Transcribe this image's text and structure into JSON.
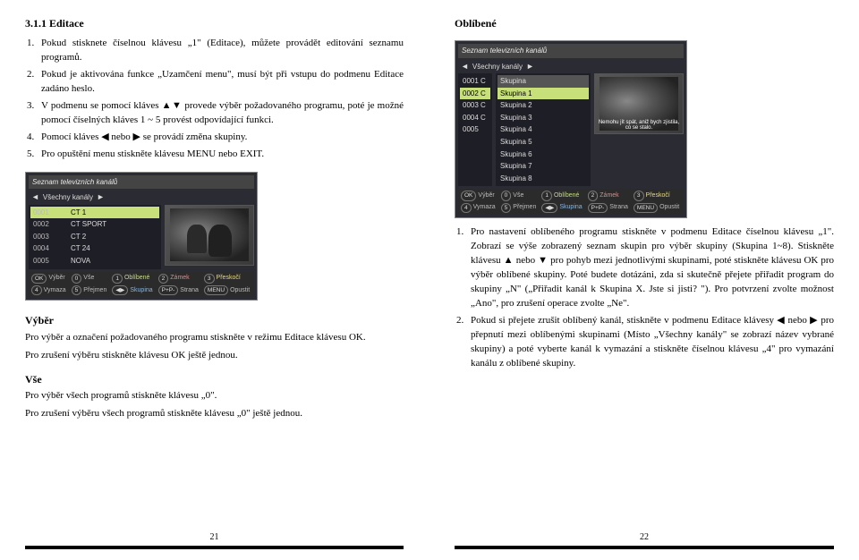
{
  "left": {
    "section_title": "3.1.1 Editace",
    "items": [
      "Pokud stisknete číselnou klávesu „1\" (Editace), můžete provádět editování seznamu programů.",
      "Pokud je aktivována funkce „Uzamčení menu\", musí být při vstupu do podmenu Editace zadáno heslo.",
      "V podmenu se pomocí kláves ▲▼ provede výběr požadovaného programu, poté je možné pomocí číselných kláves 1 ~ 5 provést odpovídající funkci.",
      "Pomocí kláves ◀ nebo ▶ se provádí změna skupiny.",
      "Pro opuštění menu stiskněte klávesu MENU nebo EXIT."
    ],
    "vyber_title": "Výběr",
    "vyber_p1": "Pro výběr a označení požadovaného programu stiskněte v režimu Editace klávesu OK.",
    "vyber_p2": "Pro zrušení výběru stiskněte klávesu OK ještě jednou.",
    "vse_title": "Vše",
    "vse_p1": "Pro výběr všech programů stiskněte klávesu „0\".",
    "vse_p2": "Pro zrušení výběru všech programů stiskněte klávesu „0\" ještě jednou.",
    "page_number": "21"
  },
  "right": {
    "oblibene_title": "Oblíbené",
    "items": [
      "Pro nastavení oblíbeného programu stiskněte v podmenu Editace číselnou klávesu „1\". Zobrazí se výše zobrazený seznam skupin pro výběr skupiny (Skupina 1~8). Stiskněte klávesu ▲ nebo ▼ pro pohyb mezi jednotlivými skupinami, poté stiskněte klávesu OK pro výběr oblíbené skupiny. Poté budete dotázáni, zda si skutečně přejete přiřadit program do skupiny „N\" („Přiřadit kanál k Skupina X. Jste si jisti? \"). Pro potvrzení zvolte možnost „Ano\", pro zrušení operace zvolte „Ne\".",
      "Pokud si přejete zrušit oblíbený kanál, stiskněte v podmenu Editace klávesy ◀ nebo ▶ pro přepnutí mezi oblíbenými skupinami (Místo „Všechny kanály\" se zobrazí název vybrané skupiny) a poté vyberte kanál k vymazání a stiskněte číselnou klávesu „4\" pro vymazání kanálu z oblíbené skupiny."
    ],
    "page_number": "22"
  },
  "screenshot1": {
    "title": "Seznam televizních kanálů",
    "group_label": "Všechny kanály",
    "channels": [
      {
        "code": "0001",
        "name": "CT 1"
      },
      {
        "code": "0002",
        "name": "CT SPORT"
      },
      {
        "code": "0003",
        "name": "CT 2"
      },
      {
        "code": "0004",
        "name": "CT 24"
      },
      {
        "code": "0005",
        "name": "NOVA"
      }
    ],
    "footer_keys": [
      {
        "k": "OK",
        "v": "Výběr"
      },
      {
        "k": "0",
        "v": "Vše"
      },
      {
        "k": "1",
        "v": "Oblíbené"
      },
      {
        "k": "2",
        "v": "Zámek"
      },
      {
        "k": "3",
        "v": "Přeskočí"
      },
      {
        "k": "4",
        "v": "Vymaza"
      },
      {
        "k": "5",
        "v": "Přejmen"
      },
      {
        "k": "◀▶",
        "v": "Skupina"
      },
      {
        "k": "P+P-",
        "v": "Strana"
      },
      {
        "k": "MENU",
        "v": "Opustit"
      }
    ]
  },
  "screenshot2": {
    "title": "Seznam televizních kanálů",
    "group_label": "Všechny kanály",
    "sub_label": "Skupina",
    "codes": [
      "0001 C",
      "0002 C",
      "0003 C",
      "0004 C",
      "0005"
    ],
    "groups": [
      "Skupina 1",
      "Skupina 2",
      "Skupina 3",
      "Skupina 4",
      "Skupina 5",
      "Skupina 6",
      "Skupina 7",
      "Skupina 8"
    ],
    "preview_caption": "Nemohu jít spát, aniž bych zjistila, co se stalo.",
    "footer_keys": [
      {
        "k": "OK",
        "v": "Výběr"
      },
      {
        "k": "0",
        "v": "Vše"
      },
      {
        "k": "1",
        "v": "Oblíbené"
      },
      {
        "k": "2",
        "v": "Zámek"
      },
      {
        "k": "3",
        "v": "Přeskočí"
      },
      {
        "k": "4",
        "v": "Vymaza"
      },
      {
        "k": "5",
        "v": "Přejmen"
      },
      {
        "k": "◀▶",
        "v": "Skupina"
      },
      {
        "k": "P+P-",
        "v": "Strana"
      },
      {
        "k": "MENU",
        "v": "Opustit"
      }
    ]
  }
}
